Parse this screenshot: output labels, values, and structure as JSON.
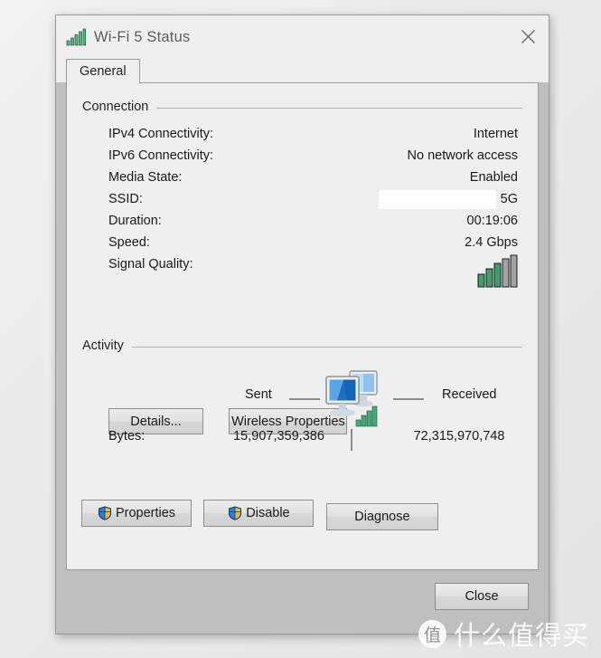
{
  "window": {
    "title": "Wi-Fi 5 Status",
    "title_icon": "signal-bars-icon",
    "close_icon": "close-icon"
  },
  "tabs": [
    {
      "label": "General",
      "selected": true
    }
  ],
  "connection": {
    "group_label": "Connection",
    "rows": [
      {
        "label": "IPv4 Connectivity:",
        "value": "Internet"
      },
      {
        "label": "IPv6 Connectivity:",
        "value": "No network access"
      },
      {
        "label": "Media State:",
        "value": "Enabled"
      },
      {
        "label": "SSID:",
        "value": "5G",
        "redacted": true
      },
      {
        "label": "Duration:",
        "value": "00:19:06"
      },
      {
        "label": "Speed:",
        "value": "2.4 Gbps"
      }
    ],
    "signal_label": "Signal Quality:",
    "signal_bars_total": 5,
    "signal_bars_active": 3,
    "buttons": {
      "details": "Details...",
      "wireless_properties": "Wireless Properties"
    }
  },
  "activity": {
    "group_label": "Activity",
    "sent_label": "Sent",
    "received_label": "Received",
    "bytes_label": "Bytes:",
    "bytes_sent": "15,907,359,386",
    "bytes_received": "72,315,970,748",
    "icon": "two-monitors-icon"
  },
  "actions": {
    "properties": "Properties",
    "disable": "Disable",
    "diagnose": "Diagnose",
    "close": "Close"
  },
  "watermark": {
    "badge": "值",
    "text": "什么值得买"
  },
  "colors": {
    "signal_green": "#2f9e63",
    "signal_gray": "#9a9a9a",
    "window_chrome": "#efefef",
    "footer": "#bfbfbf",
    "monitor_blue": "#2a7fd4"
  }
}
